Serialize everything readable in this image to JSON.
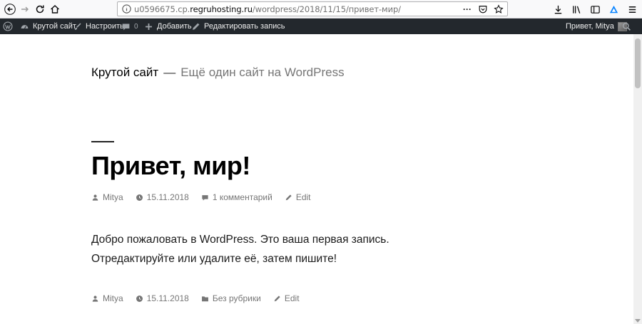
{
  "browser": {
    "url_host_prefix": "u0596675.cp.",
    "url_host": "regruhosting.ru",
    "url_path": "/wordpress/2018/11/15/привет-мир/",
    "url_more": "···"
  },
  "adminbar": {
    "site_name": "Крутой сайт",
    "customize": "Настроить",
    "comments_count": "0",
    "add_new": "Добавить",
    "edit_post": "Редактировать запись",
    "howdy": "Привет, Mitya"
  },
  "site": {
    "title": "Крутой сайт",
    "separator": "—",
    "description": "Ещё один сайт на WordPress"
  },
  "post": {
    "title": "Привет, мир!",
    "meta_top": {
      "author": "Mitya",
      "date": "15.11.2018",
      "comments": "1 комментарий",
      "edit": "Edit"
    },
    "content": [
      "Добро пожаловать в WordPress. Это ваша первая запись.",
      "Отредактируйте или удалите её, затем пишите!"
    ],
    "meta_bottom": {
      "author": "Mitya",
      "date": "15.11.2018",
      "category": "Без рубрики",
      "edit": "Edit"
    }
  },
  "colors": {
    "adminbar_bg": "#23282d",
    "meta_text": "#767676"
  }
}
